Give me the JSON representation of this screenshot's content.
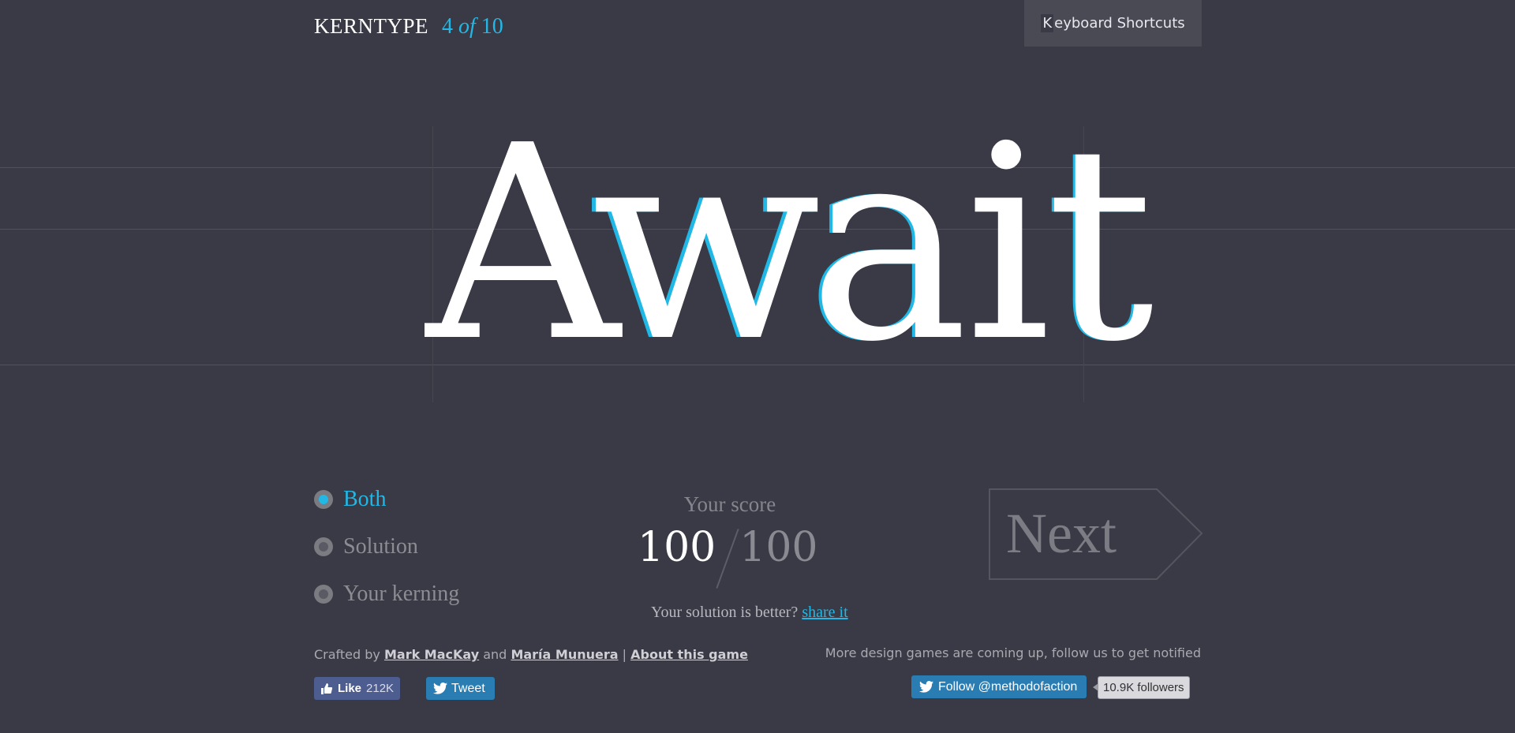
{
  "header": {
    "brand": "KERNTYPE",
    "progress_current": "4",
    "progress_of": "of",
    "progress_total": "10",
    "keyboard_key": "K",
    "keyboard_rest": "eyboard Shortcuts"
  },
  "puzzle": {
    "letters": [
      "A",
      "w",
      "a",
      "i",
      "t"
    ]
  },
  "view_options": [
    {
      "label": "Both",
      "selected": true
    },
    {
      "label": "Solution",
      "selected": false
    },
    {
      "label": "Your kerning",
      "selected": false
    }
  ],
  "score": {
    "label": "Your score",
    "value": "100",
    "total": "100"
  },
  "better": {
    "text": "Your solution is better?",
    "link": "share it"
  },
  "next_label": "Next",
  "footer": {
    "crafted_by": "Crafted by",
    "author1": "Mark MacKay",
    "and": "and",
    "author2": "María Munuera",
    "sep": "|",
    "about": "About this game",
    "coming": "More design games are coming up, follow us to get notified",
    "like_label": "Like",
    "like_count": "212K",
    "tweet_label": "Tweet",
    "follow_label": "Follow @methodofaction",
    "followers": "10.9K followers"
  },
  "colors": {
    "background": "#3a3a46",
    "accent": "#22b8e6"
  }
}
